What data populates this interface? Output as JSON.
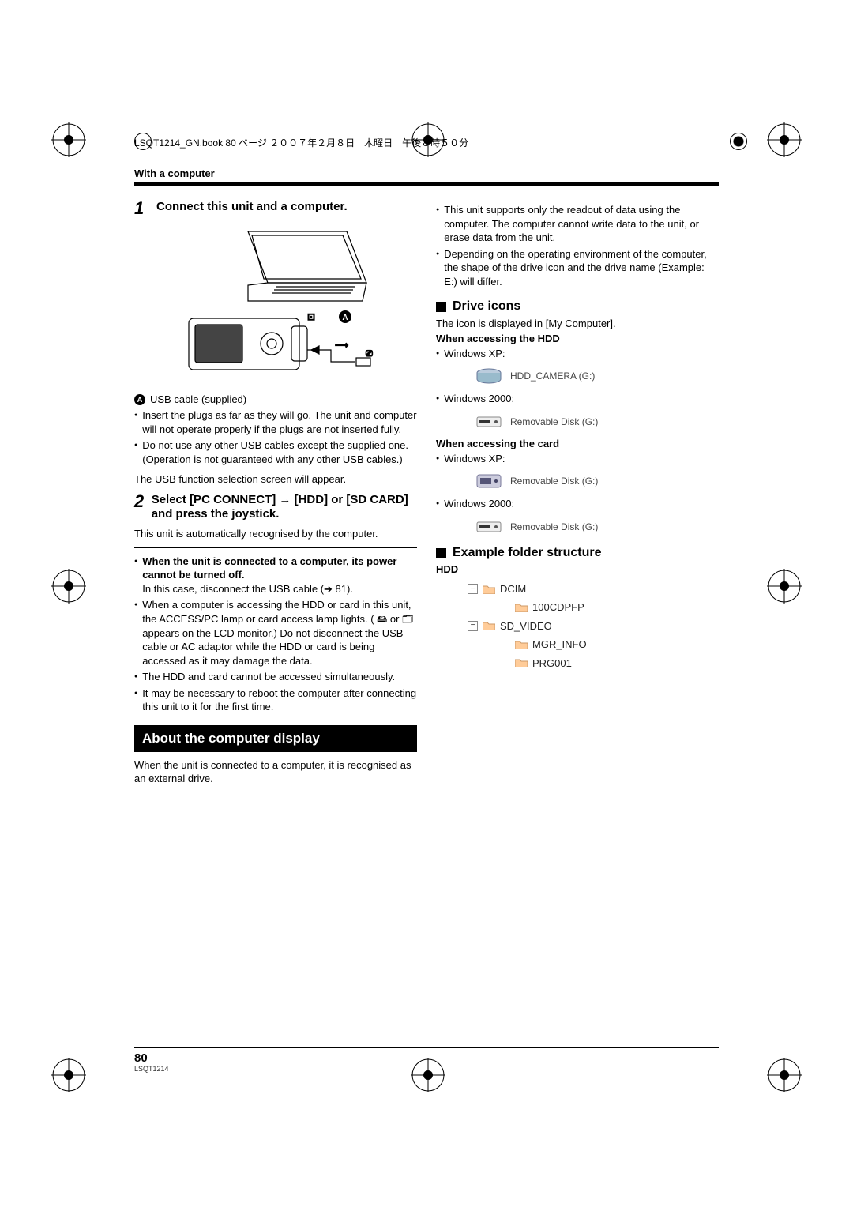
{
  "header": "LSQT1214_GN.book  80 ページ  ２００７年２月８日　木曜日　午後８時５０分",
  "section_label": "With a computer",
  "left": {
    "step1_num": "1",
    "step1_title": "Connect this unit and a computer.",
    "caption_A": "USB cable (supplied)",
    "bullets1": [
      "Insert the plugs as far as they will go. The unit and computer will not operate properly if the plugs are not inserted fully.",
      "Do not use any other USB cables except the supplied one. (Operation is not guaranteed with any other USB cables.)"
    ],
    "note1": "The USB function selection screen will appear.",
    "step2_num": "2",
    "step2_title_a": "Select [PC CONNECT] ",
    "step2_title_arrow": "→",
    "step2_title_b": " [HDD] or [SD CARD] and press the joystick.",
    "note2": "This unit is automatically recognised by the computer.",
    "bold_bullet": "When the unit is connected to a computer, its power cannot be turned off.",
    "bold_bullet_sub": "In this case, disconnect the USB cable (➔ 81).",
    "bullets2": [
      "When a computer is accessing the HDD or card in this unit, the ACCESS/PC lamp or card access lamp lights. ( 🖴 or 🗂 appears on the LCD monitor.) Do not disconnect the USB cable or AC adaptor while the HDD or card is being accessed as it may damage the data.",
      "The HDD and card cannot be accessed simultaneously.",
      "It may be necessary to reboot the computer after connecting this unit to it for the first time."
    ],
    "banner": "About the computer display",
    "banner_sub": "When the unit is connected to a computer, it is recognised as an external drive."
  },
  "right": {
    "bullets_top": [
      "This unit supports only the readout of data using the computer. The computer cannot write data to the unit, or erase data from the unit.",
      "Depending on the operating environment of the computer, the shape of the drive icon and the drive name (Example: E:) will differ."
    ],
    "sub1": "Drive icons",
    "sub1_text": "The icon is displayed in [My Computer].",
    "hdd_head": "When accessing the HDD",
    "xp_label": "Windows XP:",
    "xp_drive1": "HDD_CAMERA (G:)",
    "w2k_label": "Windows 2000:",
    "w2k_drive1": "Removable Disk (G:)",
    "card_head": "When accessing the card",
    "xp_drive2": "Removable Disk (G:)",
    "w2k_drive2": "Removable Disk (G:)",
    "sub2": "Example folder structure",
    "hdd_label": "HDD",
    "tree": {
      "dcim": "DCIM",
      "dcim_child": "100CDPFP",
      "sdv": "SD_VIDEO",
      "sdv_c1": "MGR_INFO",
      "sdv_c2": "PRG001"
    }
  },
  "footer": {
    "page": "80",
    "docid": "LSQT1214"
  }
}
